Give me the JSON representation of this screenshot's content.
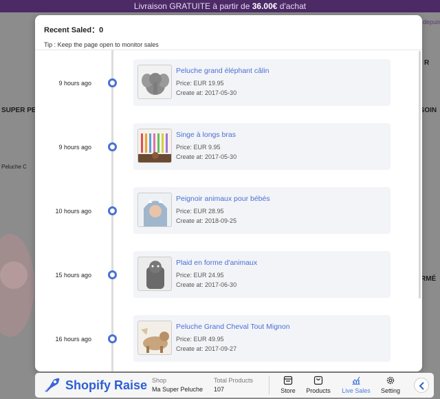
{
  "promo": {
    "text_before": "Livraison GRATUITE à partir de ",
    "amount": "36.00€",
    "text_after": " d'achat"
  },
  "background": {
    "left_heading": "SUPER PE",
    "right_heading": "ESOIN",
    "breadcrumb": "Peluche C",
    "right_snippet": "depuis",
    "right_snippet2": "R",
    "right_snippet3": "RMÉ"
  },
  "modal": {
    "recent_label": "Recent Saled：",
    "recent_count": "0",
    "tip": "Tip : Keep the page open to monitor sales",
    "price_prefix": "Price: ",
    "date_prefix": "Create at: ",
    "entries": [
      {
        "time": "9 hours ago",
        "name": "Peluche grand éléphant câlin",
        "price": "EUR 19.95",
        "date": "2017-05-30"
      },
      {
        "time": "9 hours ago",
        "name": "Singe à longs bras",
        "price": "EUR 9.95",
        "date": "2017-05-30"
      },
      {
        "time": "10 hours ago",
        "name": "Peignoir animaux pour bébés",
        "price": "EUR 28.95",
        "date": "2018-09-25"
      },
      {
        "time": "15 hours ago",
        "name": "Plaid en forme d'animaux",
        "price": "EUR 24.95",
        "date": "2017-06-30"
      },
      {
        "time": "16 hours ago",
        "name": "Peluche Grand Cheval Tout Mignon",
        "price": "EUR 49.95",
        "date": "2017-09-27"
      }
    ]
  },
  "appbar": {
    "title": "Shopify Raise",
    "shop_label": "Shop",
    "shop_value": "Ma Super Peluche",
    "products_label": "Total Products",
    "products_value": "107",
    "tabs": [
      {
        "label": "Store",
        "icon": "store-icon"
      },
      {
        "label": "Products",
        "icon": "bag-icon"
      },
      {
        "label": "Live Sales",
        "icon": "chart-icon"
      },
      {
        "label": "Setting",
        "icon": "gear-icon"
      }
    ]
  },
  "colors": {
    "accent": "#4a6fd6",
    "brand": "#2d5fd3",
    "promo_bg": "#4b2a66"
  }
}
